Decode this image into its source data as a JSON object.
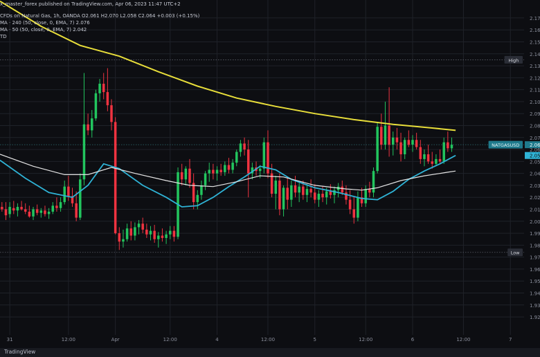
{
  "header": {
    "publisher_line": "x_master_forex published on TradingView.com, Apr 06, 2023 11:47 UTC+2",
    "symbol_line": "CFDs on Natural Gas, 1h, OANDA  O2.061  H2.070  L2.058  C2.064  +0.003 (+0.15%)",
    "ema240_line": "MA · 240 (50, close, 0, EMA, 7)  2.076",
    "ema50_line": "MA · 50 (50, close, 0, EMA, 7)  2.042",
    "extra_line": "TD"
  },
  "footer": {
    "brand": "TradingView"
  },
  "colors": {
    "background": "#0d0e12",
    "bull": "#22c55e",
    "bear": "#ef3340",
    "ema240": "#e8de3a",
    "ema50": "#e6e6e6",
    "ema_fast": "#2fb3d6",
    "grid": "#1f2229",
    "axis_text": "#8b8f9c"
  },
  "chart_data": {
    "type": "candlestick",
    "symbol": "NATGASUSD",
    "timeframe": "1h",
    "ylim": [
      1.905,
      2.185
    ],
    "y_ticks": [
      "2.17",
      "2.16",
      "2.15",
      "2.14",
      "2.13",
      "2.12",
      "2.11",
      "2.10",
      "2.09",
      "2.08",
      "2.07",
      "2.06",
      "2.05",
      "2.04",
      "2.03",
      "2.02",
      "2.01",
      "2.00",
      "1.99",
      "1.98",
      "1.97",
      "1.96",
      "1.95",
      "1.94",
      "1.93",
      "1.92"
    ],
    "x_ticks": [
      {
        "label": "31",
        "i": 2
      },
      {
        "label": "12:00",
        "i": 17
      },
      {
        "label": "Apr",
        "i": 29
      },
      {
        "label": "12:00",
        "i": 43
      },
      {
        "label": "4",
        "i": 55
      },
      {
        "label": "12:00",
        "i": 68
      },
      {
        "label": "5",
        "i": 80
      },
      {
        "label": "12:00",
        "i": 93
      },
      {
        "label": "6",
        "i": 105
      },
      {
        "label": "12:00",
        "i": 118
      },
      {
        "label": "7",
        "i": 130
      }
    ],
    "x_range": [
      -0.5,
      133.5
    ],
    "high_label": "High",
    "high_value": 2.135,
    "low_label": "Low",
    "low_value": 1.974,
    "current_label": "NATGASUSD",
    "current_value": 2.064,
    "current_price_text": "2.064",
    "ema240_price_text": "2.076",
    "ema50_price_text": "2.055",
    "ema50_current": 2.055,
    "ema240_current": 2.076,
    "candles": [
      [
        2.012,
        2.016,
        2.008,
        2.01
      ],
      [
        2.01,
        2.016,
        2.001,
        2.005
      ],
      [
        2.006,
        2.016,
        2.003,
        2.012
      ],
      [
        2.011,
        2.017,
        2.006,
        2.009
      ],
      [
        2.009,
        2.015,
        2.004,
        2.012
      ],
      [
        2.012,
        2.017,
        2.009,
        2.01
      ],
      [
        2.01,
        2.015,
        2.006,
        2.008
      ],
      [
        2.008,
        2.013,
        2.003,
        2.004
      ],
      [
        2.004,
        2.012,
        2.001,
        2.01
      ],
      [
        2.01,
        2.014,
        2.005,
        2.007
      ],
      [
        2.007,
        2.011,
        2.003,
        2.009
      ],
      [
        2.009,
        2.013,
        2.004,
        2.006
      ],
      [
        2.006,
        2.011,
        2.002,
        2.008
      ],
      [
        2.008,
        2.016,
        2.006,
        2.013
      ],
      [
        2.013,
        2.02,
        2.008,
        2.011
      ],
      [
        2.011,
        2.02,
        2.008,
        2.016
      ],
      [
        2.016,
        2.034,
        2.014,
        2.029
      ],
      [
        2.029,
        2.038,
        2.017,
        2.021
      ],
      [
        2.021,
        2.028,
        2.012,
        2.015
      ],
      [
        2.015,
        2.025,
        2.0,
        2.003
      ],
      [
        2.003,
        2.04,
        2.001,
        2.035
      ],
      [
        2.035,
        2.124,
        2.03,
        2.081
      ],
      [
        2.081,
        2.09,
        2.072,
        2.076
      ],
      [
        2.076,
        2.093,
        2.07,
        2.086
      ],
      [
        2.086,
        2.11,
        2.084,
        2.107
      ],
      [
        2.107,
        2.119,
        2.1,
        2.115
      ],
      [
        2.115,
        2.124,
        2.102,
        2.108
      ],
      [
        2.108,
        2.128,
        2.092,
        2.097
      ],
      [
        2.097,
        2.102,
        2.076,
        2.083
      ],
      [
        2.083,
        2.087,
        1.989,
        1.99
      ],
      [
        1.99,
        1.995,
        1.976,
        1.983
      ],
      [
        1.983,
        1.993,
        1.978,
        1.985
      ],
      [
        1.985,
        1.998,
        1.983,
        1.994
      ],
      [
        1.994,
        2.0,
        1.984,
        1.988
      ],
      [
        1.988,
        1.999,
        1.984,
        1.995
      ],
      [
        1.995,
        2.001,
        1.989,
        1.998
      ],
      [
        1.998,
        2.003,
        1.99,
        1.993
      ],
      [
        1.993,
        1.998,
        1.986,
        1.989
      ],
      [
        1.989,
        1.996,
        1.984,
        1.992
      ],
      [
        1.992,
        1.997,
        1.982,
        1.985
      ],
      [
        1.985,
        1.991,
        1.978,
        1.988
      ],
      [
        1.988,
        1.994,
        1.983,
        1.986
      ],
      [
        1.986,
        1.992,
        1.981,
        1.989
      ],
      [
        1.989,
        1.996,
        1.985,
        1.992
      ],
      [
        1.992,
        1.996,
        1.983,
        1.987
      ],
      [
        1.987,
        2.045,
        1.985,
        2.041
      ],
      [
        2.041,
        2.048,
        2.03,
        2.035
      ],
      [
        2.035,
        2.046,
        2.03,
        2.044
      ],
      [
        2.044,
        2.052,
        2.028,
        2.032
      ],
      [
        2.032,
        2.04,
        2.01,
        2.016
      ],
      [
        2.016,
        2.026,
        2.01,
        2.022
      ],
      [
        2.022,
        2.034,
        2.018,
        2.03
      ],
      [
        2.03,
        2.042,
        2.026,
        2.04
      ],
      [
        2.04,
        2.049,
        2.033,
        2.043
      ],
      [
        2.043,
        2.048,
        2.035,
        2.04
      ],
      [
        2.04,
        2.046,
        2.034,
        2.043
      ],
      [
        2.043,
        2.048,
        2.038,
        2.041
      ],
      [
        2.041,
        2.05,
        2.038,
        2.047
      ],
      [
        2.047,
        2.053,
        2.04,
        2.043
      ],
      [
        2.043,
        2.052,
        2.04,
        2.049
      ],
      [
        2.049,
        2.06,
        2.046,
        2.058
      ],
      [
        2.058,
        2.068,
        2.054,
        2.065
      ],
      [
        2.065,
        2.07,
        2.055,
        2.06
      ],
      [
        2.06,
        2.068,
        2.02,
        2.04
      ],
      [
        2.04,
        2.049,
        2.035,
        2.045
      ],
      [
        2.045,
        2.05,
        2.038,
        2.042
      ],
      [
        2.042,
        2.047,
        2.036,
        2.044
      ],
      [
        2.044,
        2.07,
        2.04,
        2.066
      ],
      [
        2.066,
        2.076,
        2.036,
        2.04
      ],
      [
        2.04,
        2.048,
        2.02,
        2.023
      ],
      [
        2.023,
        2.038,
        2.01,
        2.034
      ],
      [
        2.034,
        2.04,
        2.005,
        2.01
      ],
      [
        2.01,
        2.03,
        2.004,
        2.028
      ],
      [
        2.028,
        2.036,
        2.01,
        2.018
      ],
      [
        2.018,
        2.034,
        2.012,
        2.03
      ],
      [
        2.03,
        2.038,
        2.02,
        2.024
      ],
      [
        2.024,
        2.032,
        2.016,
        2.029
      ],
      [
        2.029,
        2.034,
        2.018,
        2.022
      ],
      [
        2.022,
        2.031,
        2.016,
        2.027
      ],
      [
        2.027,
        2.035,
        2.02,
        2.024
      ],
      [
        2.024,
        2.031,
        2.015,
        2.018
      ],
      [
        2.018,
        2.026,
        2.012,
        2.023
      ],
      [
        2.023,
        2.029,
        2.016,
        2.02
      ],
      [
        2.02,
        2.028,
        2.014,
        2.025
      ],
      [
        2.025,
        2.031,
        2.019,
        2.022
      ],
      [
        2.022,
        2.029,
        2.015,
        2.026
      ],
      [
        2.026,
        2.032,
        2.02,
        2.029
      ],
      [
        2.029,
        2.034,
        2.022,
        2.024
      ],
      [
        2.024,
        2.03,
        2.014,
        2.018
      ],
      [
        2.018,
        2.026,
        2.006,
        2.01
      ],
      [
        2.01,
        2.021,
        1.998,
        2.003
      ],
      [
        2.003,
        2.025,
        2.0,
        2.02
      ],
      [
        2.02,
        2.028,
        2.012,
        2.015
      ],
      [
        2.015,
        2.03,
        2.012,
        2.027
      ],
      [
        2.027,
        2.033,
        2.02,
        2.024
      ],
      [
        2.024,
        2.045,
        2.02,
        2.042
      ],
      [
        2.042,
        2.083,
        2.04,
        2.079
      ],
      [
        2.079,
        2.09,
        2.06,
        2.064
      ],
      [
        2.064,
        2.1,
        2.06,
        2.08
      ],
      [
        2.08,
        2.112,
        2.054,
        2.064
      ],
      [
        2.064,
        2.075,
        2.055,
        2.07
      ],
      [
        2.07,
        2.078,
        2.06,
        2.066
      ],
      [
        2.066,
        2.074,
        2.05,
        2.056
      ],
      [
        2.056,
        2.07,
        2.052,
        2.068
      ],
      [
        2.068,
        2.076,
        2.062,
        2.064
      ],
      [
        2.064,
        2.072,
        2.058,
        2.068
      ],
      [
        2.068,
        2.074,
        2.06,
        2.062
      ],
      [
        2.062,
        2.068,
        2.048,
        2.052
      ],
      [
        2.052,
        2.06,
        2.046,
        2.056
      ],
      [
        2.056,
        2.064,
        2.048,
        2.05
      ],
      [
        2.05,
        2.058,
        2.044,
        2.048
      ],
      [
        2.048,
        2.056,
        2.046,
        2.052
      ],
      [
        2.052,
        2.06,
        2.048,
        2.05
      ],
      [
        2.05,
        2.07,
        2.048,
        2.066
      ],
      [
        2.066,
        2.075,
        2.058,
        2.061
      ],
      [
        2.061,
        2.07,
        2.058,
        2.064
      ]
    ],
    "ema240": [
      [
        -0.5,
        2.184
      ],
      [
        10,
        2.163
      ],
      [
        20,
        2.147
      ],
      [
        30,
        2.138
      ],
      [
        40,
        2.125
      ],
      [
        50,
        2.113
      ],
      [
        60,
        2.103
      ],
      [
        70,
        2.096
      ],
      [
        80,
        2.09
      ],
      [
        90,
        2.085
      ],
      [
        100,
        2.081
      ],
      [
        110,
        2.078
      ],
      [
        116,
        2.076
      ]
    ],
    "ema50": [
      [
        -0.5,
        2.056
      ],
      [
        8,
        2.046
      ],
      [
        16,
        2.039
      ],
      [
        22,
        2.039
      ],
      [
        28,
        2.045
      ],
      [
        34,
        2.04
      ],
      [
        42,
        2.034
      ],
      [
        48,
        2.03
      ],
      [
        54,
        2.029
      ],
      [
        60,
        2.033
      ],
      [
        66,
        2.038
      ],
      [
        72,
        2.037
      ],
      [
        80,
        2.03
      ],
      [
        88,
        2.027
      ],
      [
        92,
        2.026
      ],
      [
        96,
        2.028
      ],
      [
        102,
        2.034
      ],
      [
        108,
        2.038
      ],
      [
        114,
        2.041
      ],
      [
        116,
        2.042
      ]
    ],
    "ema_fast": [
      [
        -0.5,
        2.051
      ],
      [
        6,
        2.036
      ],
      [
        12,
        2.024
      ],
      [
        18,
        2.02
      ],
      [
        22,
        2.03
      ],
      [
        26,
        2.048
      ],
      [
        30,
        2.044
      ],
      [
        36,
        2.03
      ],
      [
        42,
        2.02
      ],
      [
        46,
        2.012
      ],
      [
        50,
        2.013
      ],
      [
        54,
        2.02
      ],
      [
        58,
        2.029
      ],
      [
        62,
        2.037
      ],
      [
        66,
        2.046
      ],
      [
        70,
        2.043
      ],
      [
        74,
        2.035
      ],
      [
        80,
        2.028
      ],
      [
        86,
        2.024
      ],
      [
        92,
        2.019
      ],
      [
        96,
        2.018
      ],
      [
        100,
        2.025
      ],
      [
        104,
        2.035
      ],
      [
        108,
        2.042
      ],
      [
        112,
        2.048
      ],
      [
        116,
        2.055
      ]
    ]
  }
}
